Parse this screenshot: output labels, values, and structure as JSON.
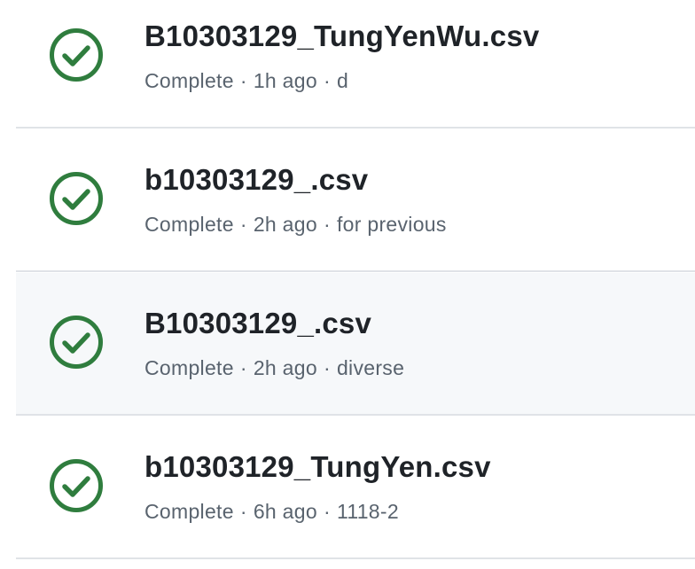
{
  "colors": {
    "success": "#2f7d3e",
    "text_primary": "#1f2328",
    "text_secondary": "#59636e",
    "divider": "#e0e3e7",
    "hover_bg": "#f6f8fa"
  },
  "status_icon": "check-circle-icon",
  "separator": "·",
  "submissions": [
    {
      "filename": "B10303129_TungYenWu.csv",
      "status": "Complete",
      "time": "1h ago",
      "description": "d"
    },
    {
      "filename": "b10303129_.csv",
      "status": "Complete",
      "time": "2h ago",
      "description": "for previous"
    },
    {
      "filename": "B10303129_.csv",
      "status": "Complete",
      "time": "2h ago",
      "description": "diverse"
    },
    {
      "filename": "b10303129_TungYen.csv",
      "status": "Complete",
      "time": "6h ago",
      "description": "1118-2"
    }
  ]
}
